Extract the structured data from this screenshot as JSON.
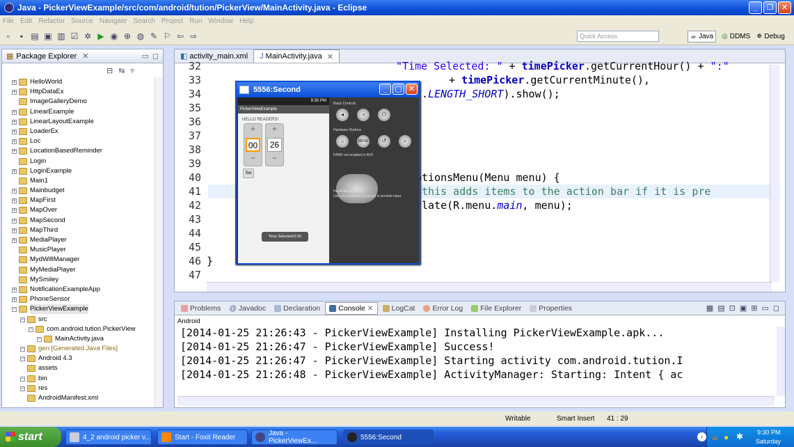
{
  "window": {
    "title": "Java - PickerViewExample/src/com/android/tution/PickerView/MainActivity.java - Eclipse"
  },
  "menu": [
    "File",
    "Edit",
    "Refactor",
    "Source",
    "Navigate",
    "Search",
    "Project",
    "Run",
    "Window",
    "Help"
  ],
  "toolbar": {
    "quick_access_placeholder": "Quick Access",
    "perspectives": [
      "Java",
      "DDMS",
      "Debug"
    ]
  },
  "package_explorer": {
    "title": "Package Explorer",
    "items": [
      {
        "label": "HelloWorld",
        "indent": 0,
        "expand": true
      },
      {
        "label": "HttpDataEx",
        "indent": 0,
        "expand": true
      },
      {
        "label": "ImageGalleryDemo",
        "indent": 0,
        "expand": false
      },
      {
        "label": "LinearExample",
        "indent": 0,
        "expand": true
      },
      {
        "label": "LinearLayoutExample",
        "indent": 0,
        "expand": true
      },
      {
        "label": "LoaderEx",
        "indent": 0,
        "expand": true
      },
      {
        "label": "Loc",
        "indent": 0,
        "expand": true
      },
      {
        "label": "LocationBasedReminder",
        "indent": 0,
        "expand": true
      },
      {
        "label": "Login",
        "indent": 0,
        "expand": false
      },
      {
        "label": "LoginExample",
        "indent": 0,
        "expand": true
      },
      {
        "label": "Main1",
        "indent": 0,
        "expand": false
      },
      {
        "label": "Mainbudget",
        "indent": 0,
        "expand": true
      },
      {
        "label": "MapFirst",
        "indent": 0,
        "expand": true
      },
      {
        "label": "MapOver",
        "indent": 0,
        "expand": true
      },
      {
        "label": "MapSecond",
        "indent": 0,
        "expand": true
      },
      {
        "label": "MapThird",
        "indent": 0,
        "expand": true
      },
      {
        "label": "MediaPlayer",
        "indent": 0,
        "expand": true
      },
      {
        "label": "MusicPlayer",
        "indent": 0,
        "expand": false
      },
      {
        "label": "MydWifiManager",
        "indent": 0,
        "expand": false
      },
      {
        "label": "MyMediaPlayer",
        "indent": 0,
        "expand": false
      },
      {
        "label": "MySmiley",
        "indent": 0,
        "expand": false
      },
      {
        "label": "NotificationExampleApp",
        "indent": 0,
        "expand": true
      },
      {
        "label": "PhoneSensor",
        "indent": 0,
        "expand": true
      },
      {
        "label": "PickerViewExample",
        "indent": 0,
        "expand": true,
        "selected": true
      },
      {
        "label": "src",
        "indent": 1,
        "expand": true
      },
      {
        "label": "com.android.tution.PickerView",
        "indent": 2,
        "expand": true
      },
      {
        "label": "MainActivity.java",
        "indent": 3,
        "expand": true
      },
      {
        "label": "gen [Generated Java Files]",
        "indent": 1,
        "expand": true
      },
      {
        "label": "Android 4.3",
        "indent": 1,
        "expand": true
      },
      {
        "label": "assets",
        "indent": 1,
        "expand": false
      },
      {
        "label": "bin",
        "indent": 1,
        "expand": true
      },
      {
        "label": "res",
        "indent": 1,
        "expand": true
      },
      {
        "label": "AndroidManifest.xml",
        "indent": 1,
        "expand": false
      }
    ]
  },
  "editor": {
    "tabs": [
      {
        "label": "activity_main.xml"
      },
      {
        "label": "MainActivity.java"
      }
    ],
    "line_numbers": [
      "32",
      "33",
      "34",
      "35",
      "36",
      "37",
      "38",
      "39",
      "40",
      "41",
      "42",
      "43",
      "44",
      "45",
      "46",
      "47"
    ]
  },
  "emulator": {
    "title": "5556:Second",
    "status_time": "9:30 PM",
    "app_title": "PickerViewExample",
    "hello": "HELLO READERS!",
    "hour": "00",
    "minute": "26",
    "set_label": "Set",
    "toast": "Time Selected:0:26",
    "basic_controls": "Basic Controls",
    "hardware_buttons": "Hardware Buttons",
    "dpad_note": "DPAD not enabled in AVD",
    "hardware_keyboard": "Hardware Keyboard",
    "keyboard_note": "Use your physical keyboard to provide input",
    "menu_label": "MENU"
  },
  "bottom_panel": {
    "tabs": [
      "Problems",
      "Javadoc",
      "Declaration",
      "Console",
      "LogCat",
      "Error Log",
      "File Explorer",
      "Properties"
    ],
    "console_name": "Android",
    "lines": [
      "[2014-01-25 21:26:43 - PickerViewExample] Installing PickerViewExample.apk...",
      "[2014-01-25 21:26:47 - PickerViewExample] Success!",
      "[2014-01-25 21:26:47 - PickerViewExample] Starting activity com.android.tution.I",
      "[2014-01-25 21:26:48 - PickerViewExample] ActivityManager: Starting: Intent { ac"
    ]
  },
  "status_bar": {
    "writable": "Writable",
    "insert_mode": "Smart Insert",
    "position": "41 : 29"
  },
  "taskbar": {
    "start_label": "start",
    "tasks": [
      "4_2 android picker v...",
      "Start - Foxit Reader",
      "Java - PickerViewEx...",
      "5556:Second"
    ],
    "clock": "9:30 PM",
    "day": "Saturday"
  }
}
